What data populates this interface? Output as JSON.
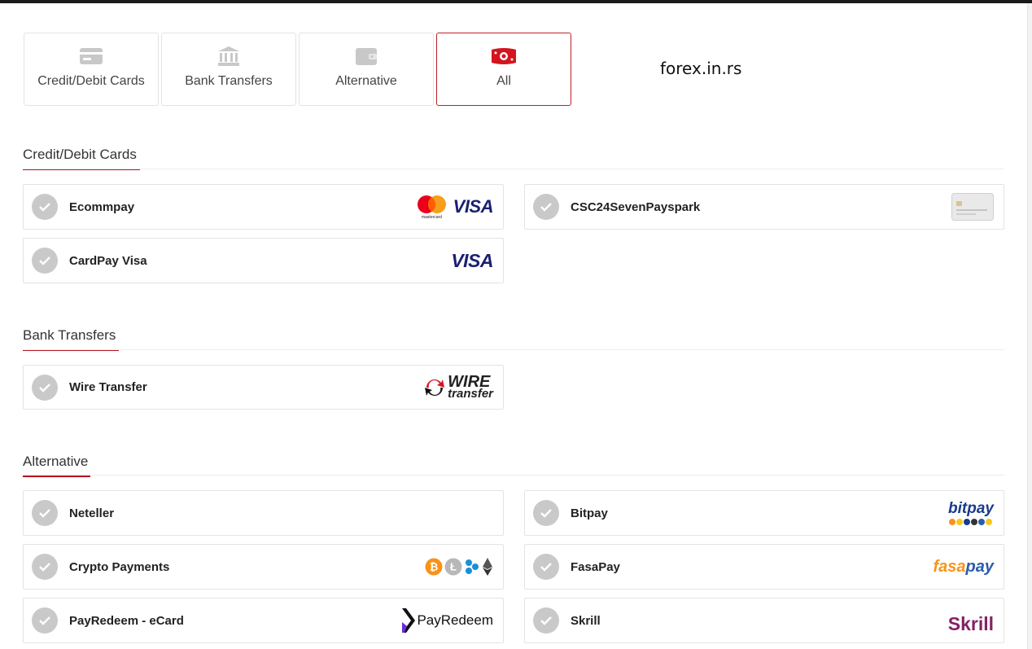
{
  "site_label": "forex.in.rs",
  "tabs": [
    {
      "label": "Credit/Debit Cards",
      "icon": "credit-card-icon"
    },
    {
      "label": "Bank Transfers",
      "icon": "bank-icon"
    },
    {
      "label": "Alternative",
      "icon": "wallet-icon"
    },
    {
      "label": "All",
      "icon": "money-bill-icon",
      "active": true
    }
  ],
  "sections": {
    "cards": {
      "title": "Credit/Debit Cards",
      "items": [
        {
          "name": "Ecommpay",
          "logo": "mastercard-visa-logo",
          "logo_text": "VISA",
          "logo_subtext": "mastercard"
        },
        {
          "name": "CSC24SevenPayspark",
          "logo": "card-image-logo"
        },
        {
          "name": "CardPay Visa",
          "logo": "visa-logo",
          "logo_text": "VISA"
        }
      ]
    },
    "bank": {
      "title": "Bank Transfers",
      "items": [
        {
          "name": "Wire Transfer",
          "logo": "wire-transfer-logo",
          "logo_text": "WIRE",
          "logo_subtext": "transfer"
        }
      ]
    },
    "alternative": {
      "title": "Alternative",
      "items": [
        {
          "name": "Neteller",
          "logo": ""
        },
        {
          "name": "Bitpay",
          "logo": "bitpay-logo",
          "logo_text": "bitpay"
        },
        {
          "name": "Crypto Payments",
          "logo": "crypto-coins-logo"
        },
        {
          "name": "FasaPay",
          "logo": "fasapay-logo",
          "logo_text": "fasa",
          "logo_subtext": "pay"
        },
        {
          "name": "PayRedeem - eCard",
          "logo": "payredeem-logo",
          "logo_text": "PayRedeem"
        },
        {
          "name": "Skrill",
          "logo": "skrill-logo",
          "logo_text": "Skrill"
        }
      ]
    }
  },
  "colors": {
    "accent": "#b5161f",
    "check": "#c9c9c9",
    "visa": "#1a1f71",
    "skrill": "#862165",
    "bitpay": "#1a3b8b",
    "fasapay_orange": "#f7941d",
    "fasapay_blue": "#2a5caa"
  }
}
